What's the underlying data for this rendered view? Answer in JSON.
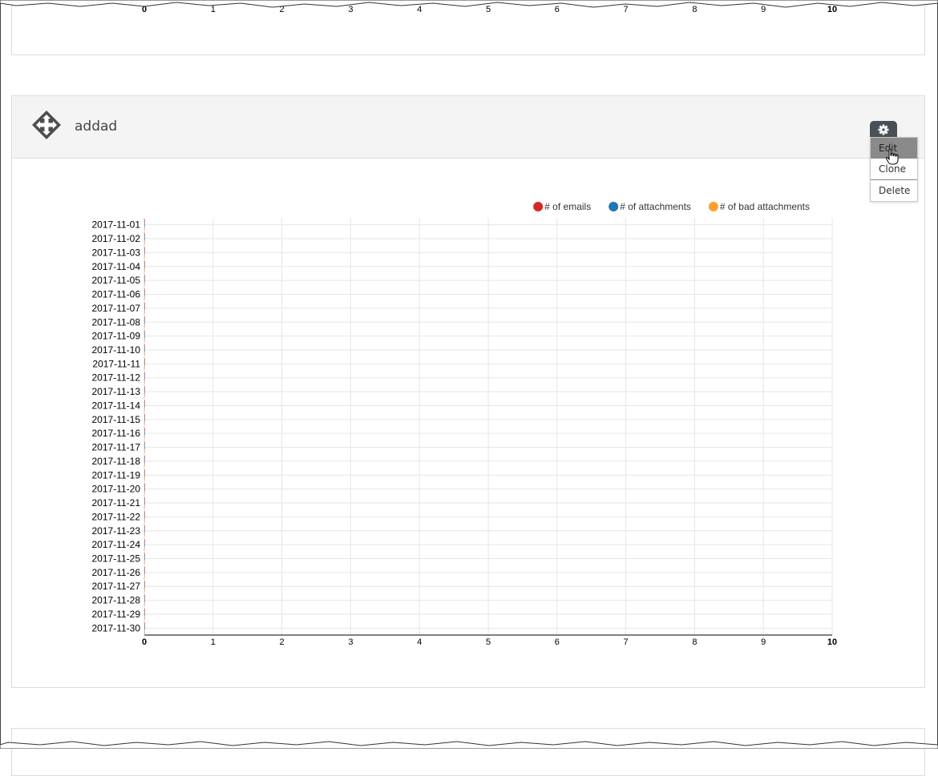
{
  "widget": {
    "title": "addad",
    "menu": [
      "Edit",
      "Clone",
      "Delete"
    ],
    "active_menu_item": "Edit"
  },
  "top_chart_axis": {
    "ticks": [
      "0",
      "1",
      "2",
      "3",
      "4",
      "5",
      "6",
      "7",
      "8",
      "9",
      "10"
    ]
  },
  "chart_data": {
    "type": "bar",
    "orientation": "horizontal",
    "categories": [
      "2017-11-01",
      "2017-11-02",
      "2017-11-03",
      "2017-11-04",
      "2017-11-05",
      "2017-11-06",
      "2017-11-07",
      "2017-11-08",
      "2017-11-09",
      "2017-11-10",
      "2017-11-11",
      "2017-11-12",
      "2017-11-13",
      "2017-11-14",
      "2017-11-15",
      "2017-11-16",
      "2017-11-17",
      "2017-11-18",
      "2017-11-19",
      "2017-11-20",
      "2017-11-21",
      "2017-11-22",
      "2017-11-23",
      "2017-11-24",
      "2017-11-25",
      "2017-11-26",
      "2017-11-27",
      "2017-11-28",
      "2017-11-29",
      "2017-11-30"
    ],
    "series": [
      {
        "name": "# of emails",
        "color": "#d62728",
        "values": [
          0,
          0,
          0,
          0,
          0,
          0,
          0,
          0,
          0,
          0,
          0,
          0,
          0,
          0,
          0,
          0,
          0,
          0,
          0,
          0,
          0,
          0,
          0,
          0,
          0,
          0,
          0,
          0,
          0,
          0
        ]
      },
      {
        "name": "# of attachments",
        "color": "#1f77b4",
        "values": [
          0,
          0,
          0,
          0,
          0,
          0,
          0,
          0,
          0,
          0,
          0,
          0,
          0,
          0,
          0,
          0,
          0,
          0,
          0,
          0,
          0,
          0,
          0,
          0,
          0,
          0,
          0,
          0,
          0,
          0
        ]
      },
      {
        "name": "# of bad attachments",
        "color": "#ff9f2e",
        "values": [
          0,
          0,
          0,
          0,
          0,
          0,
          0,
          0,
          0,
          0,
          0,
          0,
          0,
          0,
          0,
          0,
          0,
          0,
          0,
          0,
          0,
          0,
          0,
          0,
          0,
          0,
          0,
          0,
          0,
          0
        ]
      }
    ],
    "xlim": [
      0,
      10
    ],
    "xticks": [
      "0",
      "1",
      "2",
      "3",
      "4",
      "5",
      "6",
      "7",
      "8",
      "9",
      "10"
    ],
    "grid": true,
    "legend_position": "top-right"
  }
}
